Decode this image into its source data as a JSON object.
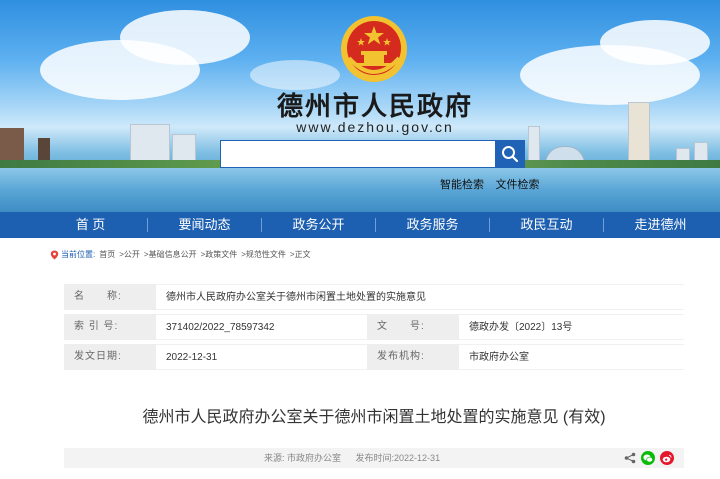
{
  "header": {
    "site_title": "德州市人民政府",
    "site_url": "www.dezhou.gov.cn",
    "search_placeholder": "",
    "search_links": [
      "智能检索",
      "文件检索"
    ]
  },
  "nav": {
    "items": [
      "首 页",
      "要闻动态",
      "政务公开",
      "政务服务",
      "政民互动",
      "走进德州"
    ]
  },
  "breadcrumb": {
    "label": "当前位置:",
    "items": [
      "首页",
      ">公开",
      ">基础信息公开",
      ">政策文件",
      ">规范性文件",
      ">正文"
    ]
  },
  "meta": {
    "name_label": "名　　称:",
    "name_value": "德州市人民政府办公室关于德州市闲置土地处置的实施意见",
    "index_label": "索 引 号:",
    "index_value": "371402/2022_78597342",
    "docno_label": "文　　号:",
    "docno_value": "德政办发〔2022〕13号",
    "date_label": "发文日期:",
    "date_value": "2022-12-31",
    "issuer_label": "发布机构:",
    "issuer_value": "市政府办公室"
  },
  "article": {
    "title": "德州市人民政府办公室关于德州市闲置土地处置的实施意见 (有效)",
    "source": "来源: 市政府办公室",
    "publish_time": "发布时间:2022-12-31"
  },
  "colors": {
    "nav_bg": "#1d5fb0",
    "search_border": "#1f62b6",
    "emblem_red": "#d52b1e",
    "emblem_gold": "#f2c230",
    "wechat_green": "#09bb07",
    "weibo_red": "#e6162d"
  }
}
